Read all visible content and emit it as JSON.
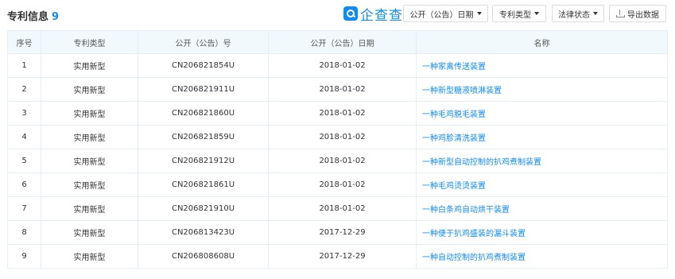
{
  "header": {
    "title": "专利信息",
    "count": "9",
    "logo_text": "企查查"
  },
  "filters": {
    "pub_date": "公开（公告）日期",
    "patent_type": "专利类型",
    "legal_status": "法律状态",
    "export": "导出数据"
  },
  "table": {
    "columns": [
      "序号",
      "专利类型",
      "公开（公告）号",
      "公开（公告）日期",
      "名称"
    ],
    "rows": [
      {
        "no": "1",
        "type": "实用新型",
        "pub_no": "CN206821854U",
        "date": "2018-01-02",
        "name": "一种家禽传送装置"
      },
      {
        "no": "2",
        "type": "实用新型",
        "pub_no": "CN206821911U",
        "date": "2018-01-02",
        "name": "一种新型糖液喷淋装置"
      },
      {
        "no": "3",
        "type": "实用新型",
        "pub_no": "CN206821860U",
        "date": "2018-01-02",
        "name": "一种毛鸡脱毛装置"
      },
      {
        "no": "4",
        "type": "实用新型",
        "pub_no": "CN206821859U",
        "date": "2018-01-02",
        "name": "一种鸡胗清洗装置"
      },
      {
        "no": "5",
        "type": "实用新型",
        "pub_no": "CN206821912U",
        "date": "2018-01-02",
        "name": "一种新型自动控制的扒鸡煮制装置"
      },
      {
        "no": "6",
        "type": "实用新型",
        "pub_no": "CN206821861U",
        "date": "2018-01-02",
        "name": "一种毛鸡烫烫装置"
      },
      {
        "no": "7",
        "type": "实用新型",
        "pub_no": "CN206821910U",
        "date": "2018-01-02",
        "name": "一种白条鸡自动烘干装置"
      },
      {
        "no": "8",
        "type": "实用新型",
        "pub_no": "CN206813423U",
        "date": "2017-12-29",
        "name": "一种便于扒鸡盛装的漏斗装置"
      },
      {
        "no": "9",
        "type": "实用新型",
        "pub_no": "CN206808608U",
        "date": "2017-12-29",
        "name": "一种自动控制的扒鸡煮制装置"
      }
    ]
  },
  "colors": {
    "accent": "#128bed",
    "header_bg": "#f2f9fc",
    "border": "#e4eef6"
  }
}
